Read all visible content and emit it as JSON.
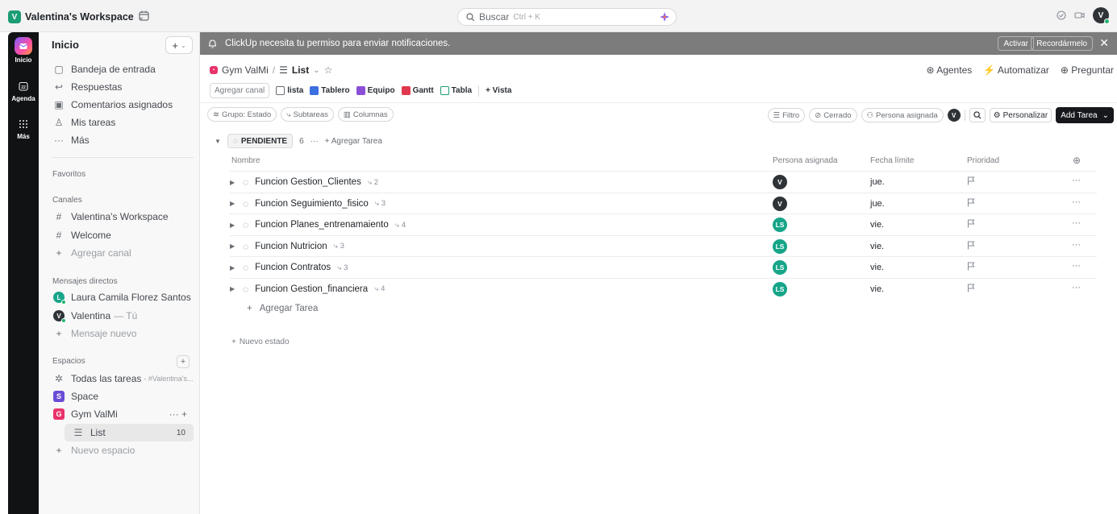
{
  "topbar": {
    "workspace_initial": "V",
    "workspace_name": "Valentina's Workspace",
    "search_placeholder": "Buscar",
    "search_shortcut": "Ctrl + K",
    "user_initial": "V"
  },
  "rail": {
    "items": [
      {
        "label": "Inicio",
        "icon": "home-icon"
      },
      {
        "label": "Agenda",
        "icon": "calendar-icon"
      },
      {
        "label": "Más",
        "icon": "grid-icon"
      }
    ]
  },
  "sidebar": {
    "title": "Inicio",
    "plus_label": "+",
    "nav": [
      {
        "label": "Bandeja de entrada",
        "icon": "inbox-icon"
      },
      {
        "label": "Respuestas",
        "icon": "reply-icon"
      },
      {
        "label": "Comentarios asignados",
        "icon": "comment-icon"
      },
      {
        "label": "Mis tareas",
        "icon": "user-tasks-icon"
      },
      {
        "label": "Más",
        "icon": "more-icon"
      }
    ],
    "favorites_label": "Favoritos",
    "channels_label": "Canales",
    "channels": [
      {
        "label": "Valentina's Workspace"
      },
      {
        "label": "Welcome"
      },
      {
        "label": "Agregar canal"
      }
    ],
    "dm_label": "Mensajes directos",
    "dms": [
      {
        "initial": "L",
        "name": "Laura Camila Florez Santos",
        "color": "#17a589"
      },
      {
        "initial": "V",
        "name": "Valentina",
        "suffix": "— Tú",
        "color": "#2f3237"
      },
      {
        "name": "Mensaje nuevo"
      }
    ],
    "spaces_label": "Espacios",
    "spaces": [
      {
        "label": "Todas las tareas",
        "suffix": "- #Valentina's..."
      },
      {
        "initial": "S",
        "label": "Space",
        "color": "#6b4cd6"
      },
      {
        "initial": "G",
        "label": "Gym ValMi",
        "color": "#e8336a"
      },
      {
        "label": "List",
        "count": "10"
      },
      {
        "label": "Nuevo espacio"
      }
    ]
  },
  "notification": {
    "text": "ClickUp necesita tu permiso para enviar notificaciones.",
    "activate": "Activar",
    "remind": "Recordármelo"
  },
  "header": {
    "space": "Gym ValMi",
    "separator": "/",
    "list": "List",
    "actions": [
      "Agentes",
      "Automatizar",
      "Preguntar"
    ]
  },
  "views": {
    "add_channel": "Agregar canal",
    "tabs": [
      {
        "label": "lista",
        "color": "#6a6e74"
      },
      {
        "label": "Tablero",
        "color": "#3b6fe0"
      },
      {
        "label": "Equipo",
        "color": "#8a4fd6"
      },
      {
        "label": "Gantt",
        "color": "#e0384f"
      },
      {
        "label": "Tabla",
        "color": "#1b9c74"
      }
    ],
    "add_view": "+ Vista"
  },
  "filters": {
    "group": "Grupo: Estado",
    "subtasks": "Subtareas",
    "columns": "Columnas",
    "filter": "Filtro",
    "closed": "Cerrado",
    "assignee": "Persona asignada",
    "assignee_initial": "V",
    "customize": "Personalizar",
    "add_task": "Add Tarea"
  },
  "group": {
    "status": "PENDIENTE",
    "count": "6",
    "more": "···",
    "add": "+ Agregar Tarea"
  },
  "table": {
    "columns": [
      "Nombre",
      "Persona asignada",
      "Fecha límite",
      "Prioridad"
    ],
    "rows": [
      {
        "name": "Funcion Gestion_Clientes",
        "subtasks": "2",
        "assignee": "V",
        "assignee_color": "#2f3237",
        "due": "jue."
      },
      {
        "name": "Funcion Seguimiento_fisico",
        "subtasks": "3",
        "assignee": "V",
        "assignee_color": "#2f3237",
        "due": "jue."
      },
      {
        "name": "Funcion Planes_entrenamaiento",
        "subtasks": "4",
        "assignee": "LS",
        "assignee_color": "#17a589",
        "due": "vie."
      },
      {
        "name": "Funcion Nutricion",
        "subtasks": "3",
        "assignee": "LS",
        "assignee_color": "#17a589",
        "due": "vie."
      },
      {
        "name": "Funcion Contratos",
        "subtasks": "3",
        "assignee": "LS",
        "assignee_color": "#17a589",
        "due": "vie."
      },
      {
        "name": "Funcion Gestion_financiera",
        "subtasks": "4",
        "assignee": "LS",
        "assignee_color": "#17a589",
        "due": "vie."
      }
    ],
    "add_task": "Agregar Tarea",
    "new_status": "Nuevo estado"
  }
}
